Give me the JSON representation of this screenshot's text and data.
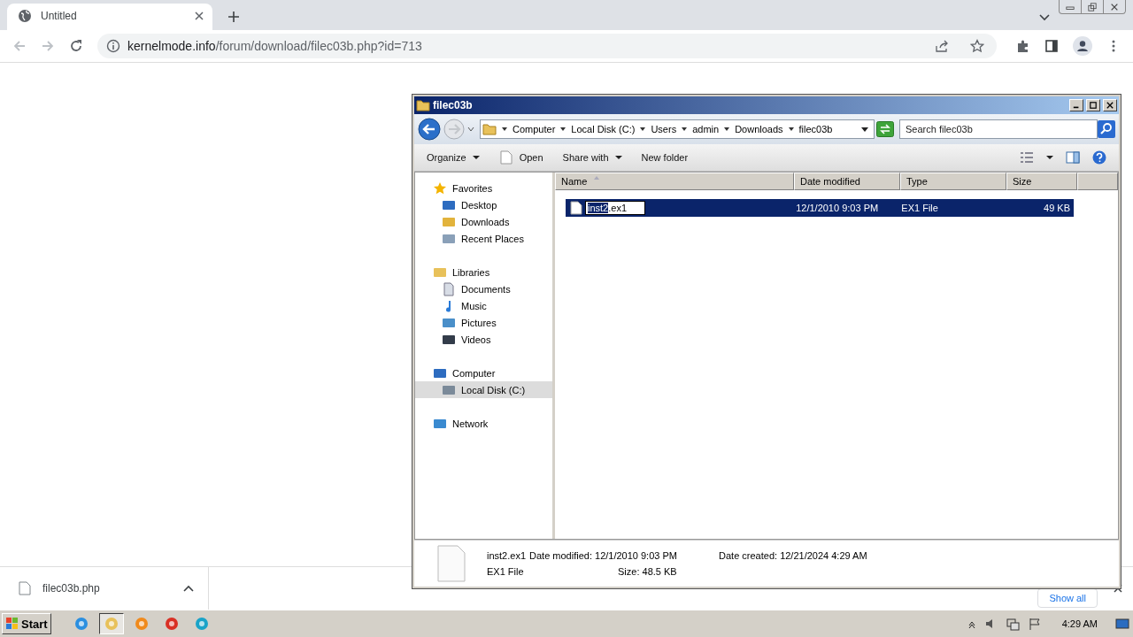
{
  "browser": {
    "tabs": [
      {
        "title": "Untitled",
        "selected": true
      }
    ],
    "address": {
      "host": "kernelmode.info",
      "path": "/forum/download/filec03b.php?id=713"
    }
  },
  "explorer": {
    "title": "filec03b",
    "breadcrumb": [
      "Computer",
      "Local Disk (C:)",
      "Users",
      "admin",
      "Downloads",
      "filec03b"
    ],
    "search": {
      "placeholder": "Search filec03b"
    },
    "commands": [
      {
        "label": "Organize",
        "kind": "menu"
      },
      {
        "label": "Open",
        "kind": "open"
      },
      {
        "label": "Share with",
        "kind": "menu"
      },
      {
        "label": "New folder",
        "kind": "plain"
      }
    ],
    "nav": [
      {
        "label": "Favorites",
        "kind": "star",
        "selected": false,
        "children": [
          {
            "label": "Desktop",
            "kind": "desktop",
            "selected": false
          },
          {
            "label": "Downloads",
            "kind": "downloads",
            "selected": false
          },
          {
            "label": "Recent Places",
            "kind": "recent",
            "selected": false
          }
        ]
      },
      {
        "label": "Libraries",
        "kind": "library",
        "selected": false,
        "children": [
          {
            "label": "Documents",
            "kind": "documents",
            "selected": false
          },
          {
            "label": "Music",
            "kind": "music",
            "selected": false
          },
          {
            "label": "Pictures",
            "kind": "pictures",
            "selected": false
          },
          {
            "label": "Videos",
            "kind": "videos",
            "selected": false
          }
        ]
      },
      {
        "label": "Computer",
        "kind": "computer",
        "selected": false,
        "children": [
          {
            "label": "Local Disk (C:)",
            "kind": "disk",
            "selected": true
          }
        ]
      },
      {
        "label": "Network",
        "kind": "network",
        "selected": false
      }
    ],
    "columns": [
      {
        "label": "Name",
        "sorted": true
      },
      {
        "label": "Date modified",
        "sorted": false
      },
      {
        "label": "Type",
        "sorted": false
      },
      {
        "label": "Size",
        "sorted": false
      }
    ],
    "rows": [
      {
        "name_base": "inst2",
        "name_ext": ".ex1",
        "renaming": true,
        "date": "12/1/2010 9:03 PM",
        "type": "EX1 File",
        "size": "49 KB",
        "selected": true
      }
    ],
    "details": {
      "name": "inst2.ex1",
      "type": "EX1 File",
      "fields": [
        {
          "label": "Date modified:",
          "value": "12/1/2010 9:03 PM"
        },
        {
          "label": "Date created:",
          "value": "12/21/2024 4:29 AM"
        },
        {
          "label": "Size:",
          "value": "48.5 KB"
        }
      ]
    }
  },
  "downloads": {
    "items": [
      {
        "filename": "filec03b.php"
      }
    ],
    "show_all": "Show all"
  },
  "taskbar": {
    "start": "Start",
    "apps": [
      {
        "kind": "ie",
        "selected": false
      },
      {
        "kind": "explorer",
        "selected": true
      },
      {
        "kind": "media",
        "selected": false
      },
      {
        "kind": "chrome",
        "selected": false
      },
      {
        "kind": "edge",
        "selected": false
      }
    ],
    "clock": "4:29 AM"
  }
}
